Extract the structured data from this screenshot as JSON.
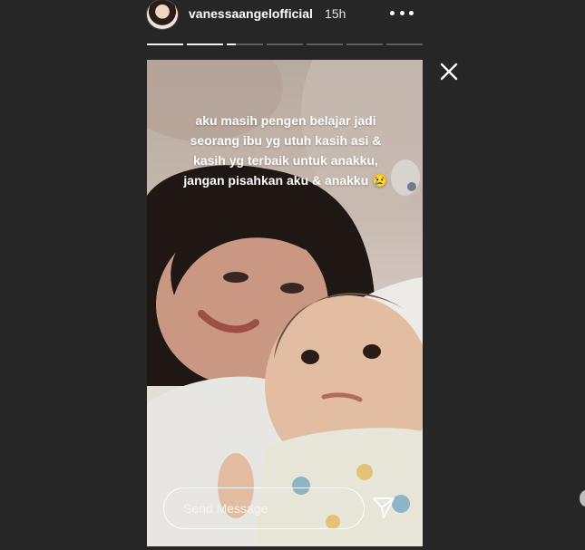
{
  "header": {
    "username": "vanessaangelofficial",
    "timestamp": "15h",
    "avatar_icon": "profile-avatar",
    "more_icon": "more-options-icon"
  },
  "progress": {
    "segments": 7,
    "completed": 2,
    "current_fraction": 0.25
  },
  "story": {
    "caption_lines": [
      "aku masih pengen belajar jadi",
      "seorang ibu yg utuh kasih asi &",
      "kasih yg terbaik untuk anakku,",
      "jangan pisahkan aku & anakku 😢"
    ]
  },
  "reply": {
    "placeholder": "Send Message",
    "send_icon": "send-icon"
  },
  "close_icon": "close-icon",
  "colors": {
    "background": "#262626",
    "text": "#ffffff",
    "progress_filled": "#f2f2f2",
    "progress_empty": "#5d5d5d"
  }
}
